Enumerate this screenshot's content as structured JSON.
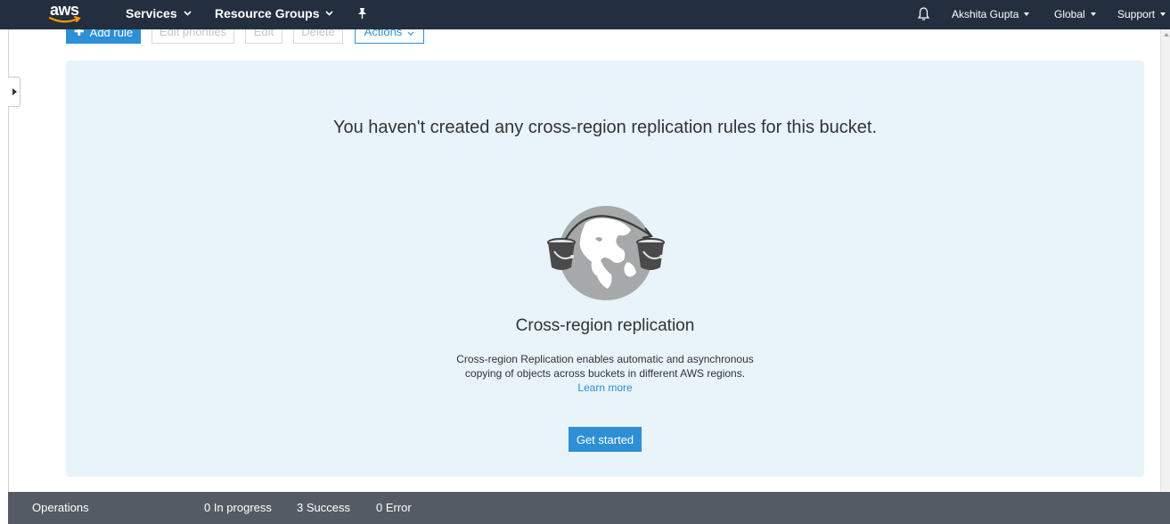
{
  "topnav": {
    "logo": "aws",
    "services": "Services",
    "resource_groups": "Resource Groups",
    "pin_icon": "pin-icon",
    "bell_icon": "bell-icon",
    "user": "Akshita Gupta",
    "region": "Global",
    "support": "Support"
  },
  "toolbar": {
    "add_rule": "Add rule",
    "edit_priorities": "Edit priorities",
    "edit": "Edit",
    "delete": "Delete",
    "actions": "Actions"
  },
  "empty_state": {
    "message": "You haven't created any cross-region replication rules for this bucket.",
    "illustration_icon": "globe-buckets-replication-icon",
    "feature_title": "Cross-region replication",
    "description_line1": "Cross-region Replication enables automatic and asynchronous",
    "description_line2": "copying of objects across buckets in different AWS regions.",
    "learn_more": "Learn more",
    "get_started": "Get started"
  },
  "operations_bar": {
    "label": "Operations",
    "in_progress": "0 In progress",
    "success": "3 Success",
    "error": "0 Error"
  },
  "colors": {
    "nav_bg": "#232f3e",
    "primary_blue": "#2d8fd5",
    "panel_bg": "#e8f3fa",
    "ops_bar_bg": "#545b64"
  }
}
